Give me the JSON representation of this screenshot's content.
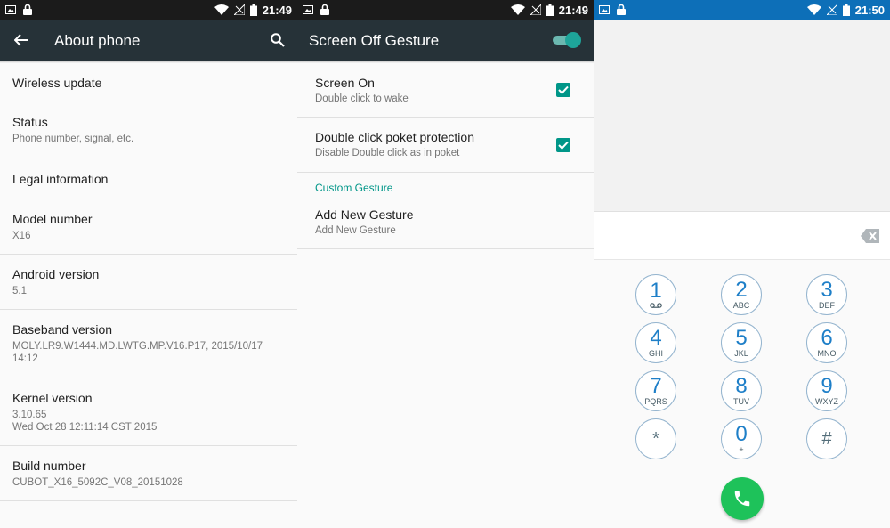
{
  "status_bars": [
    {
      "time": "21:49"
    },
    {
      "time": "21:49"
    },
    {
      "time": "21:50"
    }
  ],
  "about_phone": {
    "title": "About phone",
    "items": [
      {
        "title": "Wireless update",
        "subtitle": ""
      },
      {
        "title": "Status",
        "subtitle": "Phone number, signal, etc."
      },
      {
        "title": "Legal information",
        "subtitle": ""
      },
      {
        "title": "Model number",
        "subtitle": "X16"
      },
      {
        "title": "Android version",
        "subtitle": "5.1"
      },
      {
        "title": "Baseband version",
        "subtitle": "MOLY.LR9.W1444.MD.LWTG.MP.V16.P17, 2015/10/17 14:12"
      },
      {
        "title": "Kernel version",
        "subtitle": "3.10.65",
        "subtitle2": "Wed Oct 28 12:11:14 CST 2015"
      },
      {
        "title": "Build number",
        "subtitle": "CUBOT_X16_5092C_V08_20151028"
      }
    ]
  },
  "gesture": {
    "title": "Screen Off Gesture",
    "switch_on": true,
    "items": [
      {
        "title": "Screen On",
        "subtitle": "Double click to wake",
        "checked": true
      },
      {
        "title": "Double click poket protection",
        "subtitle": "Disable Double click as in poket",
        "checked": true
      }
    ],
    "section_header": "Custom Gesture",
    "custom_item": {
      "title": "Add New Gesture",
      "subtitle": "Add New Gesture"
    }
  },
  "dialer": {
    "keys": [
      {
        "digit": "1",
        "letters": "voicemail-icon"
      },
      {
        "digit": "2",
        "letters": "ABC"
      },
      {
        "digit": "3",
        "letters": "DEF"
      },
      {
        "digit": "4",
        "letters": "GHI"
      },
      {
        "digit": "5",
        "letters": "JKL"
      },
      {
        "digit": "6",
        "letters": "MNO"
      },
      {
        "digit": "7",
        "letters": "PQRS"
      },
      {
        "digit": "8",
        "letters": "TUV"
      },
      {
        "digit": "9",
        "letters": "WXYZ"
      },
      {
        "digit": "*",
        "letters": ""
      },
      {
        "digit": "0",
        "letters": "+"
      },
      {
        "digit": "#",
        "letters": ""
      }
    ]
  },
  "colors": {
    "toolbar": "#263238",
    "accent": "#009688",
    "dial_digit": "#1e7fc8",
    "call_button": "#1ec25a",
    "status_bar_blue": "#0d6fb8"
  }
}
